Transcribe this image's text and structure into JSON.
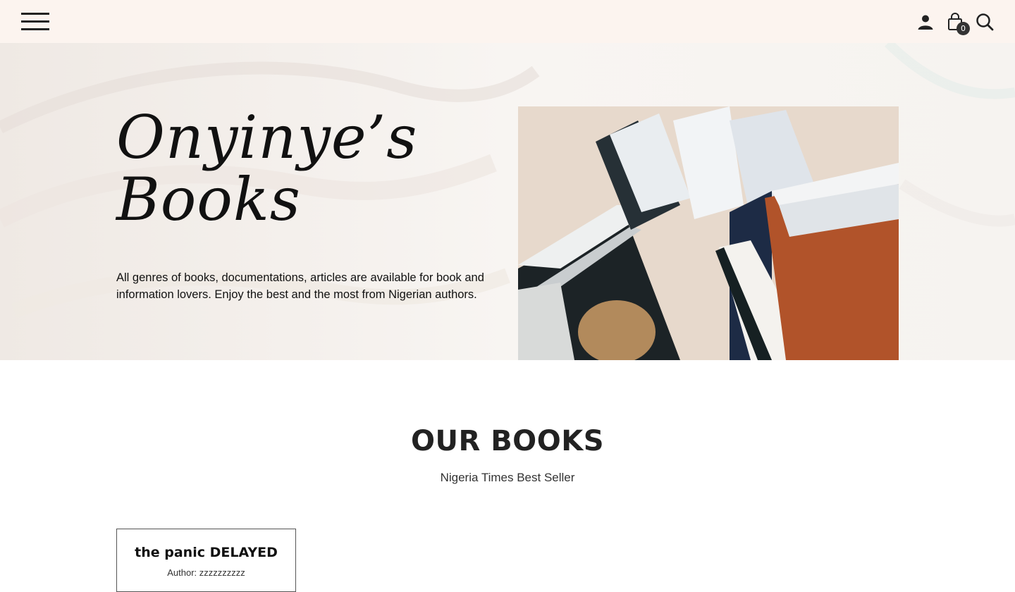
{
  "header": {
    "menu_icon": "hamburger-icon",
    "account_icon": "user-icon",
    "cart_icon": "shopping-bag-icon",
    "cart_count": "0",
    "search_icon": "search-icon",
    "background_color": "#fcf4ef"
  },
  "hero": {
    "title_line1": "Onyinye’s",
    "title_line2": "Books",
    "description": "All genres of books, documentations, articles are available for book and information lovers. Enjoy the best and the most from Nigerian authors.",
    "image_icon": "open-books-photo"
  },
  "books_section": {
    "title": "OUR BOOKS",
    "subtitle": "Nigeria Times Best Seller",
    "items": [
      {
        "title": "the panic DELAYED",
        "author": "Author: zzzzzzzzzz"
      }
    ]
  }
}
